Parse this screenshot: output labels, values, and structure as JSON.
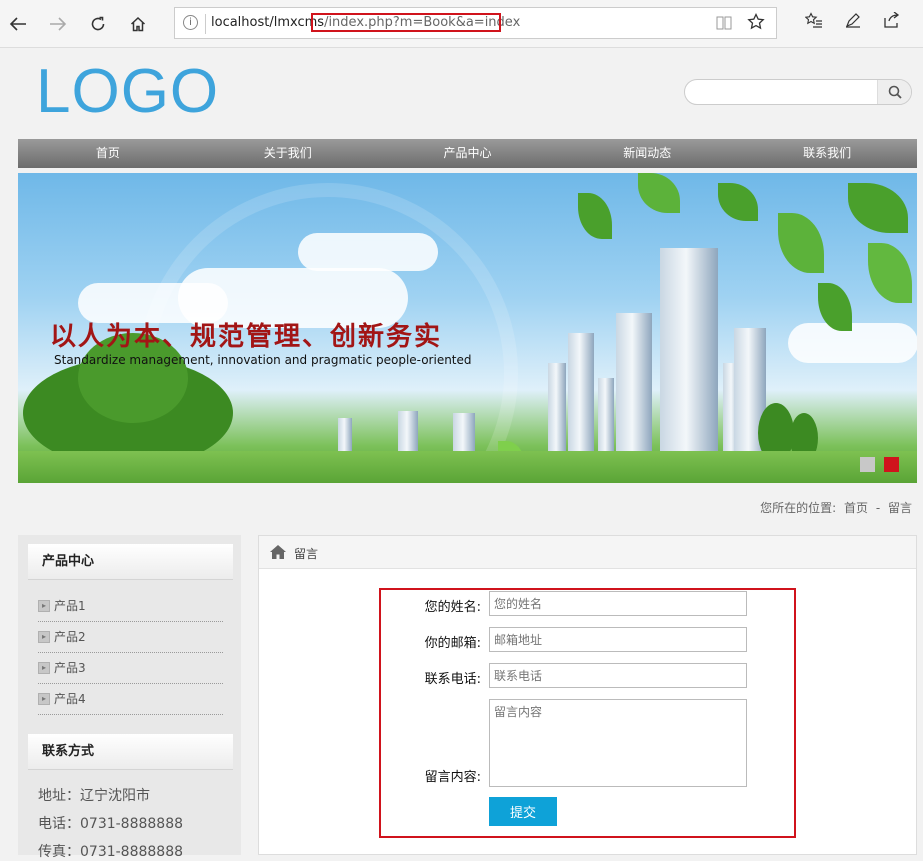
{
  "browser": {
    "url_host": "localhost/lmxcms",
    "url_path": "/index.php?m=Book&a=index",
    "info_icon": "i"
  },
  "header": {
    "logo": "LOGO",
    "search_placeholder": ""
  },
  "nav": {
    "items": [
      {
        "label": "首页"
      },
      {
        "label": "关于我们"
      },
      {
        "label": "产品中心"
      },
      {
        "label": "新闻动态"
      },
      {
        "label": "联系我们"
      }
    ]
  },
  "banner": {
    "slogan": "以人为本、规范管理、创新务实",
    "subtitle": "Standardize management, innovation and pragmatic people-oriented",
    "dot_colors": [
      "#c8c8c8",
      "#d0131c"
    ]
  },
  "breadcrumb": {
    "label": "您所在的位置:",
    "home": "首页",
    "separator": "-",
    "current": "留言"
  },
  "sidebar": {
    "products_title": "产品中心",
    "products": [
      {
        "label": "产品1"
      },
      {
        "label": "产品2"
      },
      {
        "label": "产品3"
      },
      {
        "label": "产品4"
      }
    ],
    "contact_title": "联系方式",
    "contact": {
      "address": "地址：辽宁沈阳市",
      "phone": "电话：0731-8888888",
      "fax": "传真：0731-8888888"
    }
  },
  "content": {
    "title": "留言",
    "form": {
      "name_label": "您的姓名:",
      "name_placeholder": "您的姓名",
      "email_label": "你的邮箱:",
      "email_placeholder": "邮箱地址",
      "phone_label": "联系电话:",
      "phone_placeholder": "联系电话",
      "message_label": "留言内容:",
      "message_placeholder": "留言内容",
      "submit_label": "提交"
    }
  },
  "colors": {
    "accent": "#0ea2d8",
    "highlight": "#d0131c",
    "logo": "#3ea4dc"
  }
}
